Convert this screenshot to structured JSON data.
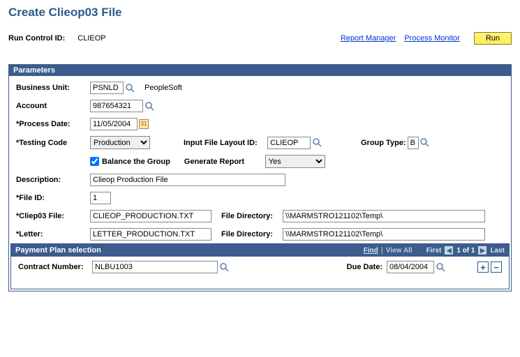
{
  "page": {
    "title": "Create Clieop03 File"
  },
  "top": {
    "run_control_label": "Run Control ID:",
    "run_control_value": "CLIEOP",
    "report_manager": "Report Manager",
    "process_monitor": "Process Monitor",
    "run": "Run"
  },
  "parameters": {
    "header": "Parameters",
    "business_unit_label": "Business Unit:",
    "business_unit_value": "PSNLD",
    "business_unit_name": "PeopleSoft",
    "account_label": "Account",
    "account_value": "987654321",
    "process_date_label": "*Process Date:",
    "process_date_value": "11/05/2004",
    "testing_code_label": "*Testing Code",
    "testing_code_value": "Production",
    "input_file_layout_label": "Input File Layout ID:",
    "input_file_layout_value": "CLIEOP",
    "group_type_label": "Group Type:",
    "group_type_value": "B",
    "balance_label": "Balance the Group",
    "generate_report_label": "Generate Report",
    "generate_report_value": "Yes",
    "description_label": "Description:",
    "description_value": "Clieop Production File",
    "file_id_label": "*File ID:",
    "file_id_value": "1",
    "clieop_file_label": "*Cliep03 File:",
    "clieop_file_value": "CLIEOP_PRODUCTION.TXT",
    "file_directory_label": "File Directory:",
    "file_directory1_value": "\\\\MARMSTRO121102\\Temp\\",
    "letter_label": "*Letter:",
    "letter_value": "LETTER_PRODUCTION.TXT",
    "file_directory2_value": "\\\\MARMSTRO121102\\Temp\\"
  },
  "payment": {
    "header": "Payment Plan selection",
    "find": "Find",
    "view_all": "View All",
    "first": "First",
    "position": "1 of 1",
    "last": "Last",
    "contract_label": "Contract Number:",
    "contract_value": "NLBU1003",
    "due_date_label": "Due Date:",
    "due_date_value": "08/04/2004"
  }
}
